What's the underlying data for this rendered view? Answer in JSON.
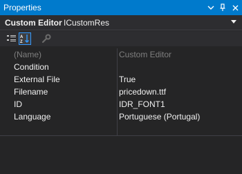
{
  "window": {
    "title": "Properties",
    "controls": [
      "chevron-down-icon",
      "pin-icon",
      "close-icon"
    ]
  },
  "selector": {
    "object_label": "Custom Editor",
    "object_name": "ICustomRes"
  },
  "toolbar": {
    "buttons": [
      "categorized-icon",
      "alphabetical-icon",
      "property-pages-icon"
    ]
  },
  "properties": [
    {
      "name": "(Name)",
      "value": "Custom Editor"
    },
    {
      "name": "Condition",
      "value": ""
    },
    {
      "name": "External File",
      "value": "True"
    },
    {
      "name": "Filename",
      "value": "pricedown.ttf"
    },
    {
      "name": "ID",
      "value": "IDR_FONT1"
    },
    {
      "name": "Language",
      "value": "Portuguese (Portugal)"
    }
  ],
  "colors": {
    "accent": "#007acc",
    "background": "#252526",
    "toolbar": "#2d2d30",
    "text": "#f1f1f1",
    "dim_text": "#7f7f7f"
  }
}
